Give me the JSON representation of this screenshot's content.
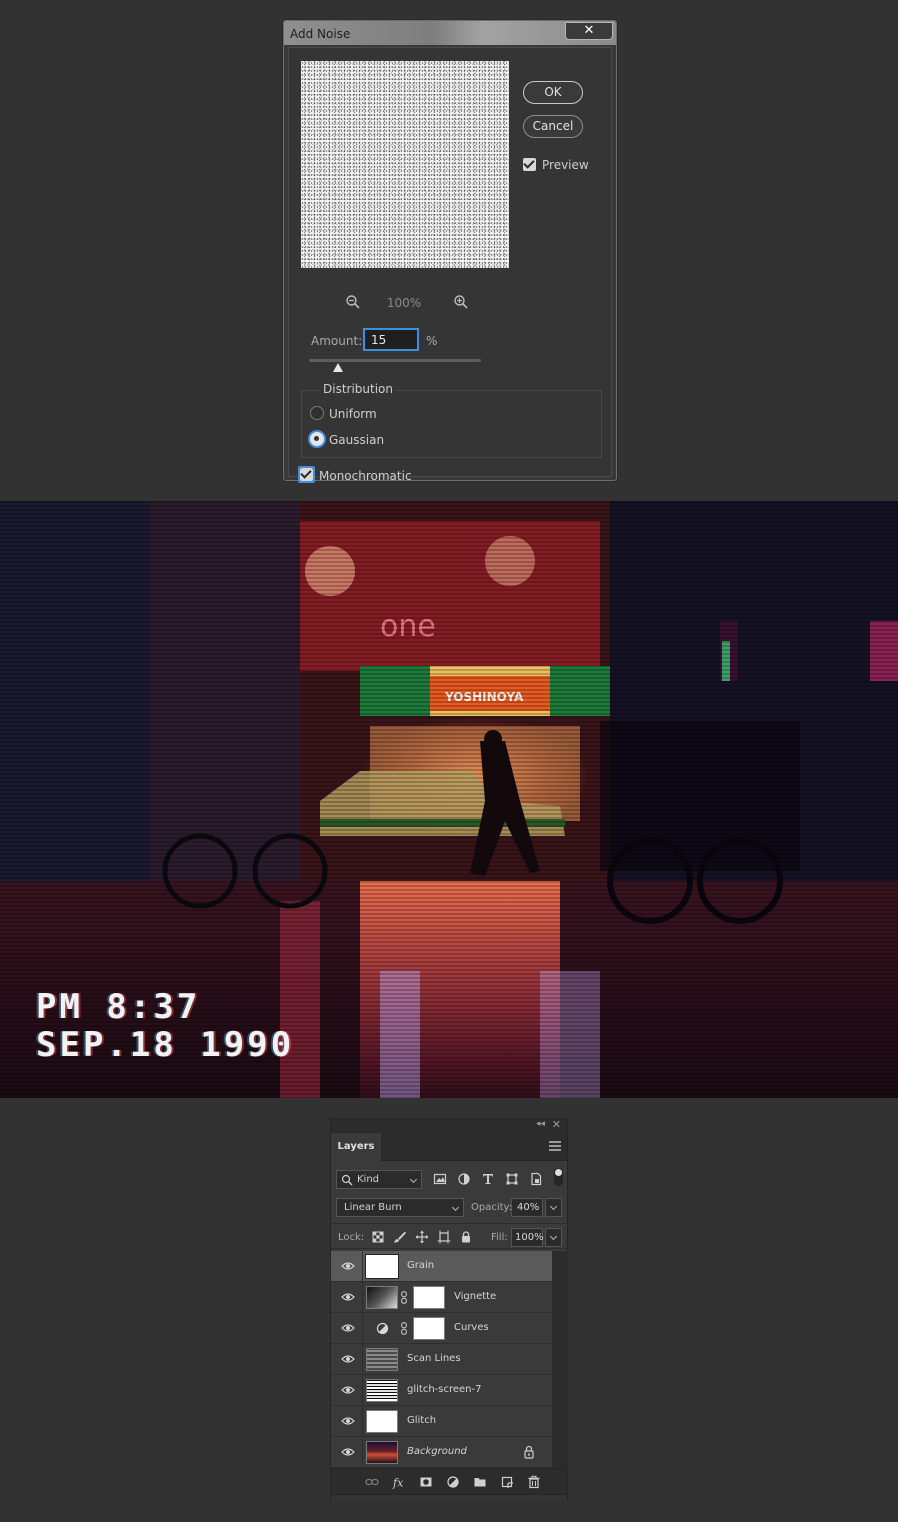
{
  "dialog": {
    "title": "Add Noise",
    "close_label": "✕",
    "ok_label": "OK",
    "cancel_label": "Cancel",
    "preview_label": "Preview",
    "preview_checked": true,
    "zoom_level": "100%",
    "amount_label": "Amount:",
    "amount_value": "15",
    "amount_unit": "%",
    "distribution_label": "Distribution",
    "uniform_label": "Uniform",
    "gaussian_label": "Gaussian",
    "selected_distribution": "Gaussian",
    "monochromatic_label": "Monochromatic",
    "monochromatic_checked": true,
    "accent_color": "#3f8fe0"
  },
  "photo": {
    "vhs_time": "PM 8:37",
    "vhs_date": "SEP.18 1990"
  },
  "layers_panel": {
    "tab_label": "Layers",
    "kind_label": "Kind",
    "blend_mode": "Linear Burn",
    "opacity_label": "Opacity:",
    "opacity_value": "40%",
    "lock_label": "Lock:",
    "fill_label": "Fill:",
    "fill_value": "100%",
    "layers": [
      {
        "name": "Grain",
        "selected": true,
        "visible": true
      },
      {
        "name": "Vignette",
        "visible": true,
        "has_mask": true
      },
      {
        "name": "Curves",
        "visible": true,
        "has_mask": true,
        "adjustment": true
      },
      {
        "name": "Scan Lines",
        "visible": true
      },
      {
        "name": "glitch-screen-7",
        "visible": true
      },
      {
        "name": "Glitch",
        "visible": true
      },
      {
        "name": "Background",
        "visible": true,
        "locked": true
      }
    ]
  }
}
